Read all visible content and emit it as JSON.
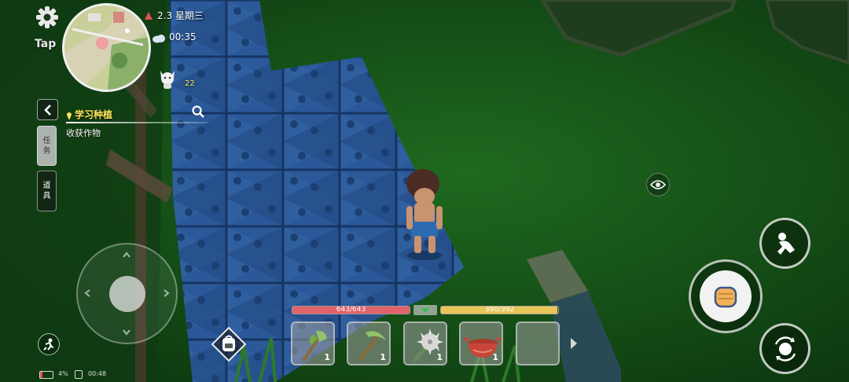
{
  "status": {
    "date": "2.3 星期三",
    "time": "00:35",
    "player_level": "22"
  },
  "hud": {
    "tap_label": "Tap"
  },
  "quest": {
    "title": "学习种植",
    "subtitle": "收获作物"
  },
  "side_tabs": {
    "tasks": "任务",
    "items": "道具"
  },
  "bars": {
    "health": "643/643",
    "stamina": "390/392",
    "health_fraction": 1.0,
    "stamina_fraction": 0.995
  },
  "hotbar": [
    {
      "icon": "axe-icon",
      "count": "1"
    },
    {
      "icon": "pickaxe-icon",
      "count": "1"
    },
    {
      "icon": "spiked-mace-icon",
      "count": "1"
    },
    {
      "icon": "clay-bowl-icon",
      "count": "1"
    },
    {
      "icon": "empty-slot",
      "count": ""
    }
  ],
  "device": {
    "battery": "4%",
    "clock": "00:48"
  },
  "colors": {
    "health_bar": "#e0636a",
    "stamina_bar": "#e8c65a",
    "grass": "#1d5a1c",
    "path_tile": "#2e5d9e",
    "quest_title": "#ffe45c"
  }
}
